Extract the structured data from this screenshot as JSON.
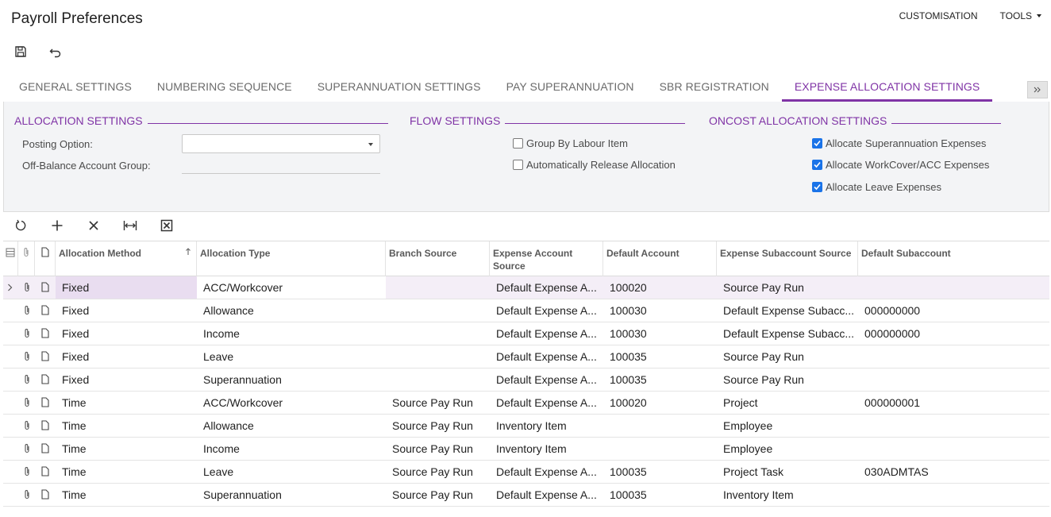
{
  "title": "Payroll Preferences",
  "top_menu": {
    "customisation": "CUSTOMISATION",
    "tools": "TOOLS"
  },
  "tabs": [
    {
      "label": "GENERAL SETTINGS",
      "active": false
    },
    {
      "label": "NUMBERING SEQUENCE",
      "active": false
    },
    {
      "label": "SUPERANNUATION SETTINGS",
      "active": false
    },
    {
      "label": "PAY SUPERANNUATION",
      "active": false
    },
    {
      "label": "SBR REGISTRATION",
      "active": false
    },
    {
      "label": "EXPENSE ALLOCATION SETTINGS",
      "active": true
    }
  ],
  "allocation": {
    "header": "ALLOCATION SETTINGS",
    "posting_label": "Posting Option:",
    "posting_value": "",
    "offbalance_label": "Off-Balance Account Group:",
    "offbalance_value": ""
  },
  "flow": {
    "header": "FLOW SETTINGS",
    "group_by": {
      "label": "Group By Labour Item",
      "checked": false
    },
    "auto_release": {
      "label": "Automatically Release Allocation",
      "checked": false
    }
  },
  "oncost": {
    "header": "ONCOST ALLOCATION SETTINGS",
    "super": {
      "label": "Allocate Superannuation Expenses",
      "checked": true
    },
    "workcover": {
      "label": "Allocate WorkCover/ACC Expenses",
      "checked": true
    },
    "leave": {
      "label": "Allocate Leave Expenses",
      "checked": true
    }
  },
  "grid": {
    "columns": {
      "method": "Allocation Method",
      "type": "Allocation Type",
      "branch": "Branch Source",
      "exp_acct_src": "Expense Account Source",
      "def_acct": "Default Account",
      "exp_sub_src": "Expense Subaccount Source",
      "def_sub": "Default Subaccount"
    },
    "rows": [
      {
        "method": "Fixed",
        "type": "ACC/Workcover",
        "branch": "",
        "exp_acct_src": "Default Expense A...",
        "def_acct": "100020",
        "exp_sub_src": "Source Pay Run",
        "def_sub": "",
        "selected": true
      },
      {
        "method": "Fixed",
        "type": "Allowance",
        "branch": "",
        "exp_acct_src": "Default Expense A...",
        "def_acct": "100030",
        "exp_sub_src": "Default Expense Subacc...",
        "def_sub": "000000000"
      },
      {
        "method": "Fixed",
        "type": "Income",
        "branch": "",
        "exp_acct_src": "Default Expense A...",
        "def_acct": "100030",
        "exp_sub_src": "Default Expense Subacc...",
        "def_sub": "000000000"
      },
      {
        "method": "Fixed",
        "type": "Leave",
        "branch": "",
        "exp_acct_src": "Default Expense A...",
        "def_acct": "100035",
        "exp_sub_src": "Source Pay Run",
        "def_sub": ""
      },
      {
        "method": "Fixed",
        "type": "Superannuation",
        "branch": "",
        "exp_acct_src": "Default Expense A...",
        "def_acct": "100035",
        "exp_sub_src": "Source Pay Run",
        "def_sub": ""
      },
      {
        "method": "Time",
        "type": "ACC/Workcover",
        "branch": "Source Pay Run",
        "exp_acct_src": "Default Expense A...",
        "def_acct": "100020",
        "exp_sub_src": "Project",
        "def_sub": "000000001"
      },
      {
        "method": "Time",
        "type": "Allowance",
        "branch": "Source Pay Run",
        "exp_acct_src": "Inventory Item",
        "def_acct": "",
        "exp_sub_src": "Employee",
        "def_sub": ""
      },
      {
        "method": "Time",
        "type": "Income",
        "branch": "Source Pay Run",
        "exp_acct_src": "Inventory Item",
        "def_acct": "",
        "exp_sub_src": "Employee",
        "def_sub": ""
      },
      {
        "method": "Time",
        "type": "Leave",
        "branch": "Source Pay Run",
        "exp_acct_src": "Default Expense A...",
        "def_acct": "100035",
        "exp_sub_src": "Project Task",
        "def_sub": "030ADMTAS"
      },
      {
        "method": "Time",
        "type": "Superannuation",
        "branch": "Source Pay Run",
        "exp_acct_src": "Default Expense A...",
        "def_acct": "100035",
        "exp_sub_src": "Inventory Item",
        "def_sub": ""
      }
    ]
  },
  "colors": {
    "accent": "#8034a6",
    "checkbox": "#1a73e8",
    "panel_bg": "#f3f4f6"
  }
}
